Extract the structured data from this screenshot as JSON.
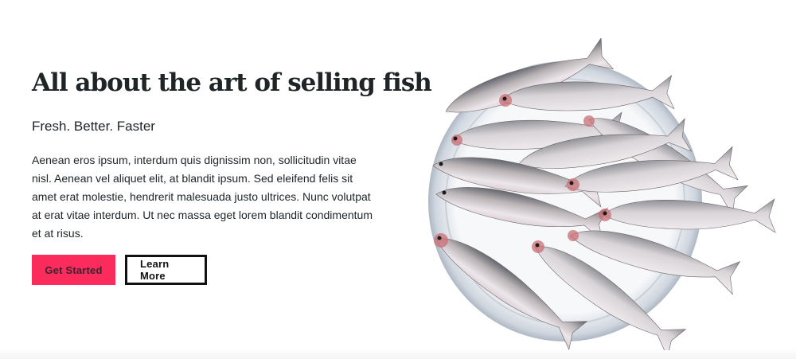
{
  "hero": {
    "title": "All about the art of selling fish",
    "subtitle": "Fresh. Better. Faster",
    "body": "Aenean eros ipsum, interdum quis dignissim non, sollicitudin vitae nisl. Aenean vel aliquet elit, at blandit ipsum. Sed eleifend felis sit amet erat molestie, hendrerit malesuada justo ultrices. Nunc volutpat at erat vitae interdum. Ut nec massa eget lorem blandit condimentum et at risus.",
    "primary_button": "Get Started",
    "secondary_button": "Learn More"
  },
  "colors": {
    "accent": "#fb2b5c",
    "text": "#1d2327"
  },
  "image": {
    "subject": "fish-on-plate-image"
  }
}
